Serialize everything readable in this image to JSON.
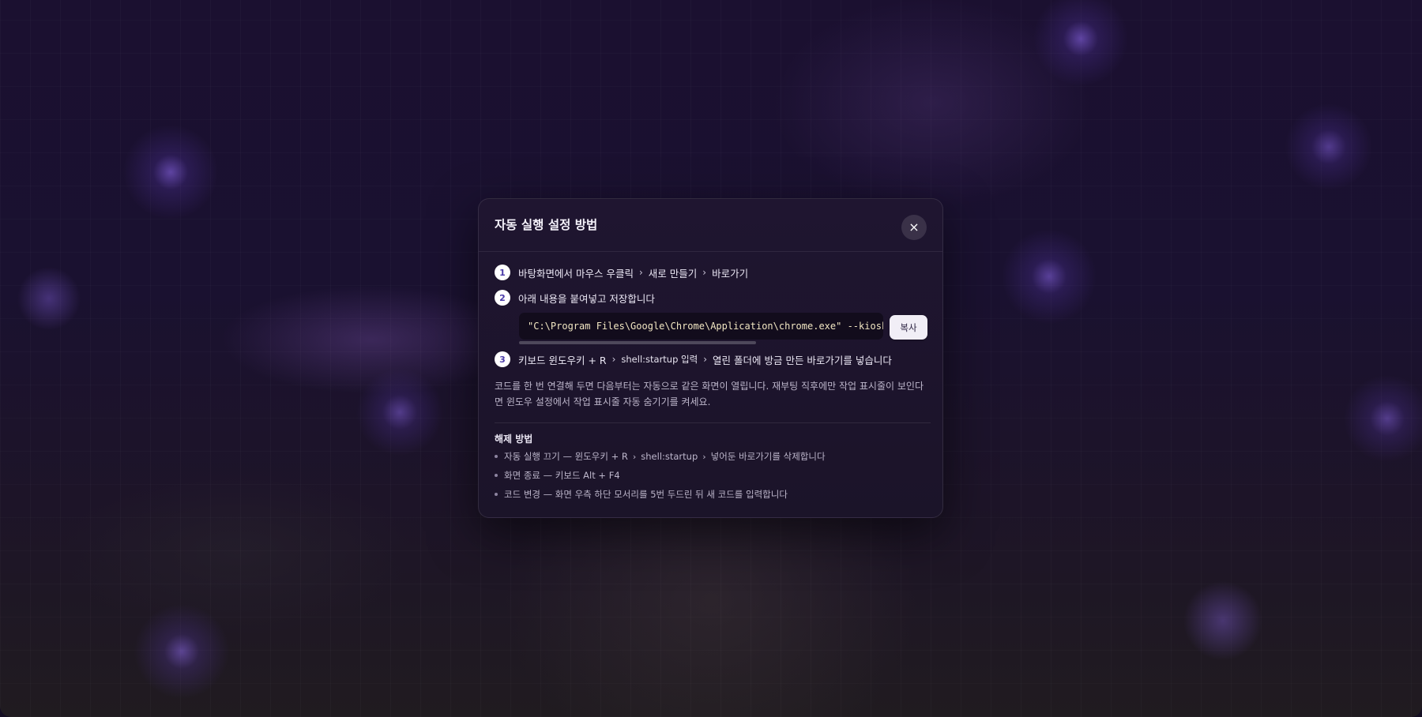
{
  "modal": {
    "title": "자동 실행 설정 방법",
    "close_icon": "×",
    "steps": [
      {
        "num": "1",
        "parts": [
          "바탕화면에서 마우스 우클릭",
          "새로 만들기",
          "바로가기"
        ]
      },
      {
        "num": "2",
        "text": "아래 내용을 붙여넣고 저장합니다"
      },
      {
        "num": "3",
        "parts": [
          "키보드 윈도우키 + R",
          "shell:startup 입력",
          "열린 폴더에 방금 만든 바로가기를 넣습니다"
        ]
      }
    ],
    "code": "\"C:\\Program Files\\Google\\Chrome\\Application\\chrome.exe\" --kiosk",
    "copy_label": "복사",
    "note": "코드를 한 번 연결해 두면 다음부터는 자동으로 같은 화면이 열립니다. 재부팅 직후에만 작업 표시줄이 보인다면 윈도우 설정에서 작업 표시줄 자동 숨기기를 켜세요.",
    "disable": {
      "title": "해제 방법",
      "items": [
        {
          "parts": [
            "자동 실행 끄기 — 윈도우키 + R",
            "shell:startup",
            "넣어둔 바로가기를 삭제합니다"
          ]
        },
        {
          "parts": [
            "화면 종료 — 키보드 Alt + F4"
          ]
        },
        {
          "parts": [
            "코드 변경 — 화면 우측 하단 모서리를 5번 두드린 뒤 새 코드를 입력합니다"
          ]
        }
      ]
    },
    "chevron": "›"
  }
}
